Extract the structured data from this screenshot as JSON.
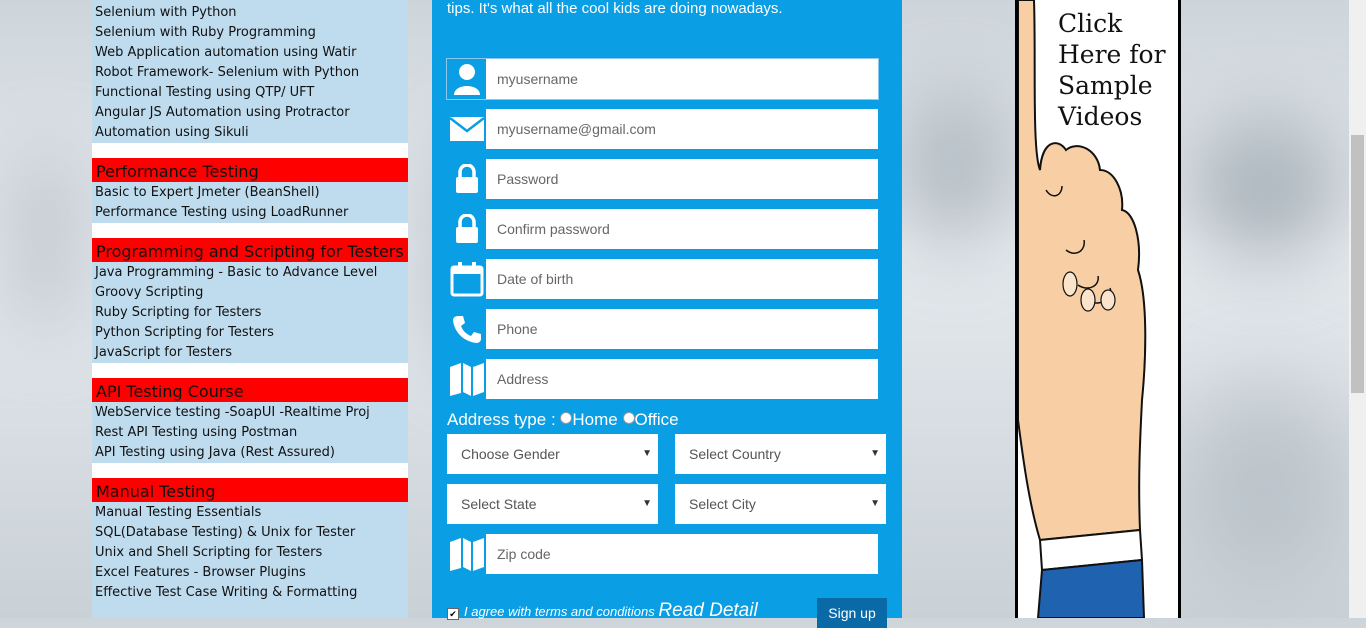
{
  "sidebar": {
    "top_items": [
      "Selenium with Python",
      "Selenium with Ruby Programming",
      "Web Application automation using Watir",
      "Robot Framework- Selenium with Python",
      "Functional Testing using QTP/ UFT",
      "Angular JS Automation using Protractor",
      "Automation using Sikuli"
    ],
    "performance": {
      "heading": "Performance Testing",
      "items": [
        "Basic to Expert Jmeter (BeanShell)",
        "Performance Testing using LoadRunner"
      ]
    },
    "programming": {
      "heading": "Programming and Scripting for Testers",
      "items": [
        "Java Programming - Basic to Advance Level",
        "Groovy Scripting",
        "Ruby Scripting for Testers",
        "Python Scripting for Testers",
        "JavaScript for Testers"
      ]
    },
    "api": {
      "heading": "API Testing Course",
      "items": [
        "WebService testing -SoapUI -Realtime Proj",
        "Rest API Testing using Postman",
        "API Testing using Java (Rest Assured)"
      ]
    },
    "manual": {
      "heading": "Manual Testing",
      "items": [
        "Manual Testing Essentials",
        "SQL(Database Testing) & Unix for Tester",
        "Unix and Shell Scripting for Testers",
        "Excel Features - Browser Plugins",
        "Effective Test Case Writing & Formatting"
      ]
    }
  },
  "form": {
    "intro": "tips. It's what all the cool kids are doing nowadays.",
    "username_placeholder": "myusername",
    "email_placeholder": "myusername@gmail.com",
    "password_placeholder": "Password",
    "confirm_placeholder": "Confirm password",
    "dob_placeholder": "Date of birth",
    "phone_placeholder": "Phone",
    "address_placeholder": "Address",
    "address_type_label": "Address type :",
    "home_label": "Home",
    "office_label": "Office",
    "gender": "Choose Gender",
    "country": "Select Country",
    "state": "Select State",
    "city": "Select City",
    "zip_placeholder": "Zip code",
    "agree_text": "I agree with terms and conditions",
    "read_detail": "Read Detail",
    "signup_label": "Sign up",
    "accent_color": "#0a9ee5"
  },
  "ad": {
    "line1": "Click",
    "line2": "Here for",
    "line3": "Sample",
    "line4": "Videos"
  },
  "icons": [
    "user-icon",
    "envelope-icon",
    "lock-icon",
    "calendar-icon",
    "phone-icon",
    "map-icon"
  ]
}
